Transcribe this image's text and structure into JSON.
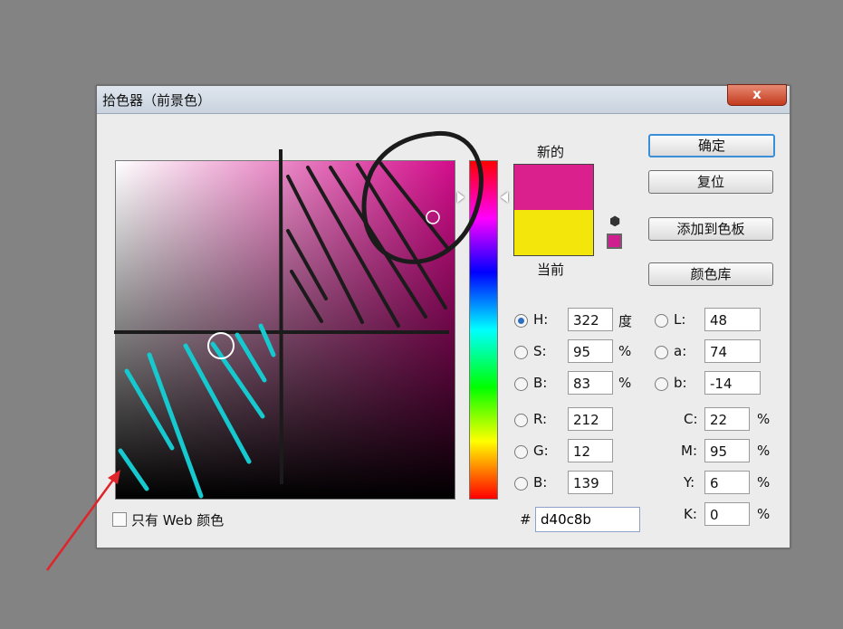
{
  "dialog": {
    "title": "拾色器（前景色）",
    "close_label": "x"
  },
  "swatch": {
    "new_label": "新的",
    "current_label": "当前",
    "new_color": "#d9208d",
    "current_color": "#f3e60a"
  },
  "buttons": {
    "ok": "确定",
    "reset": "复位",
    "add_to_swatches": "添加到色板",
    "color_libraries": "颜色库"
  },
  "hsb": {
    "h": {
      "label": "H:",
      "value": "322",
      "unit": "度"
    },
    "s": {
      "label": "S:",
      "value": "95",
      "unit": "%"
    },
    "b": {
      "label": "B:",
      "value": "83",
      "unit": "%"
    }
  },
  "rgb": {
    "r": {
      "label": "R:",
      "value": "212"
    },
    "g": {
      "label": "G:",
      "value": "12"
    },
    "b": {
      "label": "B:",
      "value": "139"
    }
  },
  "lab": {
    "l": {
      "label": "L:",
      "value": "48"
    },
    "a": {
      "label": "a:",
      "value": "74"
    },
    "b": {
      "label": "b:",
      "value": "-14"
    }
  },
  "cmyk": {
    "c": {
      "label": "C:",
      "value": "22",
      "unit": "%"
    },
    "m": {
      "label": "M:",
      "value": "95",
      "unit": "%"
    },
    "y": {
      "label": "Y:",
      "value": "6",
      "unit": "%"
    },
    "k": {
      "label": "K:",
      "value": "0",
      "unit": "%"
    }
  },
  "hex": {
    "label": "#",
    "value": "d40c8b"
  },
  "web_only": {
    "label": "只有 Web 颜色",
    "checked": false
  },
  "colors": {
    "selected": "#d40c8b",
    "annotation_cyan": "#16c9cf",
    "annotation_black": "#1b1b1b",
    "arrow_red": "#e0242b"
  }
}
